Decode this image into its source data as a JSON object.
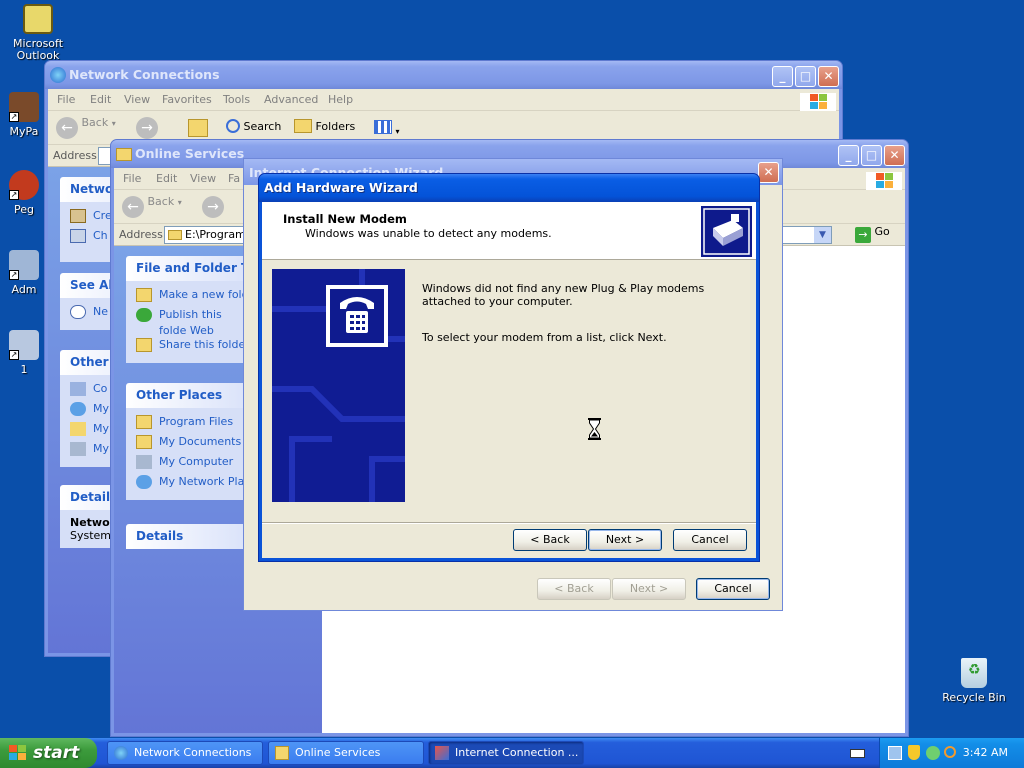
{
  "desktop": {
    "icons": [
      {
        "label": "Microsoft Outlook",
        "icon": "outlook-icon"
      },
      {
        "label": "MyPa",
        "icon": "mypa-icon"
      },
      {
        "label": "Peg",
        "icon": "peg-icon"
      },
      {
        "label": "Adm",
        "icon": "admin-icon"
      },
      {
        "label": "1",
        "icon": "computer-icon"
      }
    ],
    "recycle_bin": "Recycle Bin"
  },
  "network_window": {
    "title": "Network Connections",
    "menu": [
      "File",
      "Edit",
      "View",
      "Favorites",
      "Tools",
      "Advanced",
      "Help"
    ],
    "toolbar": {
      "back": "Back",
      "search": "Search",
      "folders": "Folders"
    },
    "address_label": "Address",
    "panels": [
      {
        "title": "Network",
        "items": [
          "Cre",
          "Ch set"
        ]
      },
      {
        "title": "See Als",
        "items": [
          "Ne"
        ]
      },
      {
        "title": "Other",
        "items": [
          "Co",
          "My",
          "My",
          "My"
        ]
      },
      {
        "title": "Details",
        "items": [
          "Netwo",
          "System"
        ]
      }
    ]
  },
  "online_window": {
    "title": "Online Services",
    "menu": [
      "File",
      "Edit",
      "View",
      "Fa"
    ],
    "toolbar": {
      "back": "Back"
    },
    "address_label": "Address",
    "address_value": "E:\\Program",
    "go_label": "Go",
    "file_tasks": {
      "title": "File and Folder Tas",
      "items": [
        "Make a new fold",
        "Publish this folde Web",
        "Share this folder"
      ]
    },
    "other_places": {
      "title": "Other Places",
      "items": [
        "Program Files",
        "My Documents",
        "My Computer",
        "My Network Plac"
      ]
    },
    "details_title": "Details"
  },
  "icw_dialog": {
    "title": "Internet Connection Wizard",
    "back": "< Back",
    "next": "Next >",
    "cancel": "Cancel"
  },
  "wizard": {
    "title": "Add Hardware Wizard",
    "header_title": "Install New Modem",
    "header_subtitle": "Windows was unable to detect any modems.",
    "body_line1": "Windows did not find any new Plug & Play modems",
    "body_line2": "attached to your computer.",
    "body_line3": "To select your modem from a list, click Next.",
    "back": "< Back",
    "next": "Next >",
    "cancel": "Cancel"
  },
  "taskbar": {
    "start": "start",
    "tasks": [
      "Network Connections",
      "Online Services",
      "Internet Connection ..."
    ],
    "clock": "3:42 AM"
  },
  "colors": {
    "desktop": "#0a4faa",
    "xp_title_blue": "#0453d8",
    "task_pane": "#6375d6"
  }
}
